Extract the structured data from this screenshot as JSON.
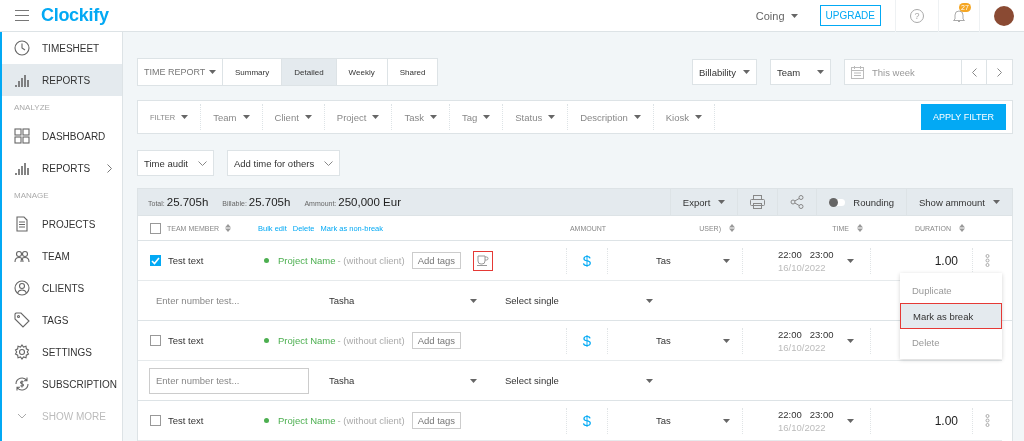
{
  "header": {
    "logo": "Clockify",
    "workspace": "Coing",
    "upgrade": "UPGRADE",
    "notification_count": "27",
    "help": "?"
  },
  "sidebar": {
    "sections": [
      {
        "items": [
          {
            "label": "TIMESHEET",
            "selected": false,
            "has_submenu": false
          },
          {
            "label": "REPORTS",
            "selected": true,
            "has_submenu": false
          }
        ]
      },
      {
        "title": "ANALYZE",
        "items": [
          {
            "label": "DASHBOARD",
            "selected": false,
            "has_submenu": false
          },
          {
            "label": "REPORTS",
            "selected": false,
            "has_submenu": true
          }
        ]
      },
      {
        "title": "MANAGE",
        "items": [
          {
            "label": "PROJECTS",
            "selected": false,
            "has_submenu": false
          },
          {
            "label": "TEAM",
            "selected": false,
            "has_submenu": false
          },
          {
            "label": "CLIENTS",
            "selected": false,
            "has_submenu": false
          },
          {
            "label": "TAGS",
            "selected": false,
            "has_submenu": false
          },
          {
            "label": "SETTINGS",
            "selected": false,
            "has_submenu": false
          },
          {
            "label": "SUBSCRIPTION",
            "selected": false,
            "has_submenu": false
          }
        ]
      }
    ],
    "show_more": "SHOW MORE"
  },
  "report_bar": {
    "type": "TIME REPORT",
    "tabs": [
      {
        "label": "Summary",
        "selected": false
      },
      {
        "label": "Detailed",
        "selected": true
      },
      {
        "label": "Weekly",
        "selected": false
      },
      {
        "label": "Shared",
        "selected": false
      }
    ],
    "billability": "Billability",
    "team": "Team",
    "date_range": "This week"
  },
  "filter_bar": {
    "label": "FILTER",
    "filters": [
      "Team",
      "Client",
      "Project",
      "Task",
      "Tag",
      "Status",
      "Description",
      "Kiosk"
    ],
    "apply": "APPLY FILTER"
  },
  "options": [
    "Time audit",
    "Add time for others"
  ],
  "summary": {
    "total_label": "Total:",
    "total": "25.705h",
    "billable_label": "Billable:",
    "billable": "25.705h",
    "amount_label": "Ammount:",
    "amount": "250,000 Eur",
    "export": "Export",
    "rounding": {
      "label": "Rounding",
      "on": false
    },
    "show_amount": "Show ammount"
  },
  "table": {
    "select_all": false,
    "columns": {
      "team_member": "TEAM MEMBER",
      "amount": "AMMOUNT",
      "user": "USER)",
      "time": "TIME",
      "duration": "DURATION"
    },
    "bulk_actions": [
      "Bulk edit",
      "Delete",
      "Mark as non-break"
    ],
    "rows": [
      {
        "checked": true,
        "description": "Test text",
        "project": "Project Name",
        "client": "- (without client)",
        "add_tags": "Add tags",
        "break": true,
        "billable": "$",
        "user": "Tas",
        "start": "22:00",
        "end": "23:00",
        "date": "16/10/2022",
        "duration": "1.00",
        "actions_visible": true,
        "detail": {
          "placeholder": "Enter number test...",
          "outlined": false,
          "user": "Tasha",
          "select": "Select single"
        }
      },
      {
        "checked": false,
        "description": "Test text",
        "project": "Project Name",
        "client": "- (without client)",
        "add_tags": "Add tags",
        "break": false,
        "billable": "$",
        "user": "Tas",
        "start": "22:00",
        "end": "23:00",
        "date": "16/10/2022",
        "actions_visible": false,
        "detail": {
          "placeholder": "Enter number test...",
          "outlined": true,
          "user": "Tasha",
          "select": "Select single"
        }
      },
      {
        "checked": false,
        "description": "Test text",
        "project": "Project Name",
        "client": "- (without client)",
        "add_tags": "Add tags",
        "break": false,
        "billable": "$",
        "user": "Tas",
        "start": "22:00",
        "end": "23:00",
        "date": "16/10/2022",
        "duration": "1.00",
        "actions_visible": true
      }
    ],
    "row_menu": {
      "items": [
        {
          "label": "Duplicate",
          "selected": false
        },
        {
          "label": "Mark as break",
          "selected": true
        },
        {
          "label": "Delete",
          "selected": false
        }
      ]
    }
  }
}
